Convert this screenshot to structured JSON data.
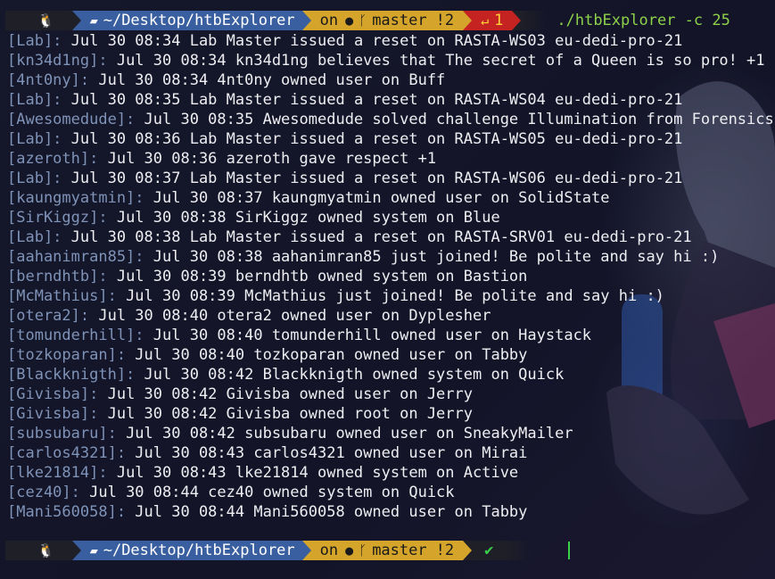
{
  "prompt_top": {
    "os_icon": "linux-tux-icon",
    "folder_icon": "folder-icon",
    "path": "~/Desktop/htbExplorer",
    "on_label": "on",
    "git_icon": "github-icon",
    "branch_icon": "git-branch-icon",
    "branch": "master",
    "git_status": "!2",
    "error_icon": "return-arrow-icon",
    "exit_code": "1",
    "command": "./htbExplorer -c 25"
  },
  "log_lines": [
    {
      "user": "[Lab]:",
      "msg": " Jul 30 08:34 Lab Master issued a reset on RASTA-WS03 eu-dedi-pro-21"
    },
    {
      "user": "[kn34d1ng]:",
      "msg": " Jul 30 08:34 kn34d1ng believes that The secret of a Queen is so pro! +1"
    },
    {
      "user": "[4nt0ny]:",
      "msg": " Jul 30 08:34 4nt0ny owned user on Buff"
    },
    {
      "user": "[Lab]:",
      "msg": " Jul 30 08:35 Lab Master issued a reset on RASTA-WS04 eu-dedi-pro-21"
    },
    {
      "user": "[Awesomedude]:",
      "msg": " Jul 30 08:35 Awesomedude solved challenge Illumination from Forensics"
    },
    {
      "user": "[Lab]:",
      "msg": " Jul 30 08:36 Lab Master issued a reset on RASTA-WS05 eu-dedi-pro-21"
    },
    {
      "user": "[azeroth]:",
      "msg": " Jul 30 08:36 azeroth gave respect +1"
    },
    {
      "user": "[Lab]:",
      "msg": " Jul 30 08:37 Lab Master issued a reset on RASTA-WS06 eu-dedi-pro-21"
    },
    {
      "user": "[kaungmyatmin]:",
      "msg": " Jul 30 08:37 kaungmyatmin owned user on SolidState"
    },
    {
      "user": "[SirKiggz]:",
      "msg": " Jul 30 08:38 SirKiggz owned system on Blue"
    },
    {
      "user": "[Lab]:",
      "msg": " Jul 30 08:38 Lab Master issued a reset on RASTA-SRV01 eu-dedi-pro-21"
    },
    {
      "user": "[aahanimran85]:",
      "msg": " Jul 30 08:38 aahanimran85 just joined! Be polite and say hi :)"
    },
    {
      "user": "[berndhtb]:",
      "msg": " Jul 30 08:39 berndhtb owned system on Bastion"
    },
    {
      "user": "[McMathius]:",
      "msg": " Jul 30 08:39 McMathius just joined! Be polite and say hi :)"
    },
    {
      "user": "[otera2]:",
      "msg": " Jul 30 08:40 otera2 owned user on Dyplesher"
    },
    {
      "user": "[tomunderhill]:",
      "msg": " Jul 30 08:40 tomunderhill owned user on Haystack"
    },
    {
      "user": "[tozkoparan]:",
      "msg": " Jul 30 08:40 tozkoparan owned user on Tabby"
    },
    {
      "user": "[Blackknigth]:",
      "msg": " Jul 30 08:42 Blackknigth owned system on Quick"
    },
    {
      "user": "[Givisba]:",
      "msg": " Jul 30 08:42 Givisba owned user on Jerry"
    },
    {
      "user": "[Givisba]:",
      "msg": " Jul 30 08:42 Givisba owned root on Jerry"
    },
    {
      "user": "[subsubaru]:",
      "msg": " Jul 30 08:42 subsubaru owned user on SneakyMailer"
    },
    {
      "user": "[carlos4321]:",
      "msg": " Jul 30 08:43 carlos4321 owned user on Mirai"
    },
    {
      "user": "[lke21814]:",
      "msg": " Jul 30 08:43 lke21814 owned system on Active"
    },
    {
      "user": "[cez40]:",
      "msg": " Jul 30 08:44 cez40 owned system on Quick"
    },
    {
      "user": "[Mani560058]:",
      "msg": " Jul 30 08:44 Mani560058 owned user on Tabby"
    }
  ],
  "prompt_bottom": {
    "os_icon": "linux-tux-icon",
    "folder_icon": "folder-icon",
    "path": "~/Desktop/htbExplorer",
    "on_label": "on",
    "git_icon": "github-icon",
    "branch_icon": "git-branch-icon",
    "branch": "master",
    "git_status": "!2",
    "ok_icon": "checkmark-icon"
  },
  "colors": {
    "background": "#121225",
    "path_segment": "#3a5fa0",
    "git_segment": "#d4a52a",
    "error_segment": "#c52222",
    "command_text": "#8ed14a",
    "username_text": "#7f93b8"
  }
}
